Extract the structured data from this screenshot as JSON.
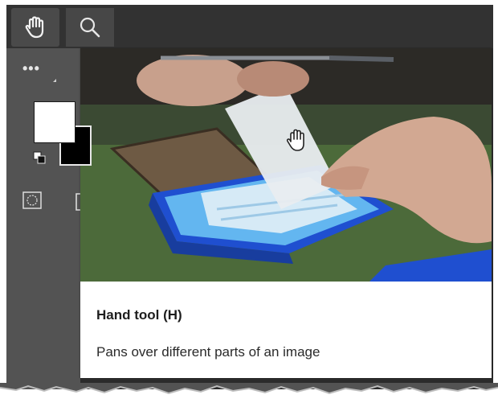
{
  "toolbar": {
    "tools": [
      {
        "name": "hand",
        "icon": "hand-icon",
        "selected": true
      },
      {
        "name": "zoom",
        "icon": "magnifier-icon",
        "selected": false
      }
    ],
    "more_tools_label": "•••"
  },
  "colors": {
    "foreground": "#ffffff",
    "background": "#000000",
    "panel": "#535353",
    "toolbar": "#323232"
  },
  "tooltip": {
    "title": "Hand tool (H)",
    "description": "Pans over different parts of an image",
    "preview_image": "hand dragging a sheet over a blue printed board on a green cutting mat"
  }
}
